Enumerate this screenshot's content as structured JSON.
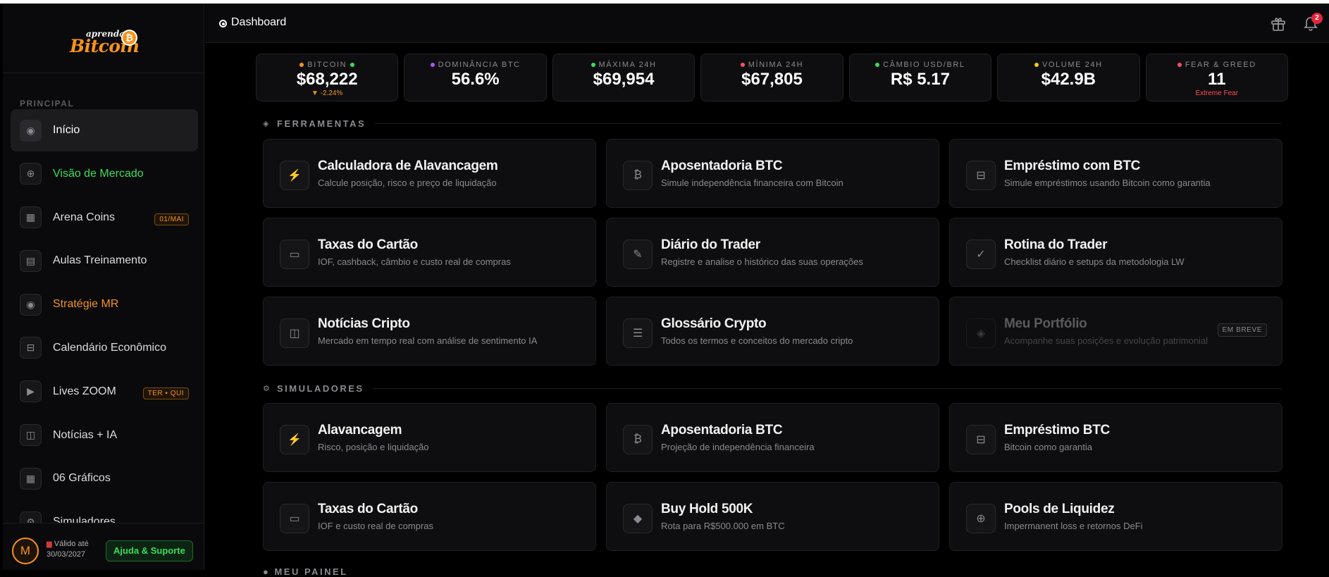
{
  "sidebar": {
    "logo_small": "aprenda",
    "logo_big": "Bitcoin",
    "logo_coin": "₿",
    "section_label": "PRINCIPAL",
    "items": [
      {
        "label": "Início",
        "icon": "target-icon",
        "glyph": "◉",
        "color": "white",
        "active": true
      },
      {
        "label": "Visão de Mercado",
        "icon": "globe-icon",
        "glyph": "⊕",
        "color": "green"
      },
      {
        "label": "Arena Coins",
        "icon": "store-icon",
        "glyph": "▦",
        "color": "default",
        "badge": "01/MAI"
      },
      {
        "label": "Aulas Treinamento",
        "icon": "book-icon",
        "glyph": "▤",
        "color": "default"
      },
      {
        "label": "Stratégie MR",
        "icon": "target-icon",
        "glyph": "◉",
        "color": "orange"
      },
      {
        "label": "Calendário Econômico",
        "icon": "calendar-icon",
        "glyph": "⊟",
        "color": "default"
      },
      {
        "label": "Lives ZOOM",
        "icon": "play-icon",
        "glyph": "▶",
        "color": "default",
        "badge": "TER • QUI"
      },
      {
        "label": "Notícias + IA",
        "icon": "news-icon",
        "glyph": "◫",
        "color": "default"
      },
      {
        "label": "06 Gráficos",
        "icon": "grid-icon",
        "glyph": "▦",
        "color": "default"
      },
      {
        "label": "Simuladores",
        "icon": "gear-icon",
        "glyph": "⚙",
        "color": "default"
      }
    ],
    "footer": {
      "avatar_letter": "M",
      "valid_label": "Válido até",
      "valid_date": "30/03/2027",
      "support_label": "Ajuda & Suporte"
    }
  },
  "header": {
    "title": "Dashboard",
    "notification_count": "2"
  },
  "stats": [
    {
      "label": "BITCOIN",
      "value": "$68,222",
      "sub": "▼ -2.24%",
      "sub_color": "orange",
      "dot": "#f7931a",
      "dot2": "#3ddc5c"
    },
    {
      "label": "DOMINÂNCIA BTC",
      "value": "56.6%",
      "dot": "#a855f7"
    },
    {
      "label": "MÁXIMA 24H",
      "value": "$69,954",
      "dot": "#3ddc5c"
    },
    {
      "label": "MÍNIMA 24H",
      "value": "$67,805",
      "dot": "#ff4d6d"
    },
    {
      "label": "CÂMBIO USD/BRL",
      "value": "R$ 5.17",
      "dot": "#3ddc5c"
    },
    {
      "label": "VOLUME 24H",
      "value": "$42.9B",
      "dot": "#f7c51a"
    },
    {
      "label": "FEAR & GREED",
      "value": "11",
      "sub": "Extreme Fear",
      "sub_color": "red",
      "dot": "#ff4d6d"
    }
  ],
  "ferramentas": {
    "title": "FERRAMENTAS",
    "glyph": "◈",
    "cards": [
      {
        "title": "Calculadora de Alavancagem",
        "desc": "Calcule posição, risco e preço de liquidação",
        "icon": "bolt-icon",
        "glyph": "⚡"
      },
      {
        "title": "Aposentadoria BTC",
        "desc": "Simule independência financeira com Bitcoin",
        "icon": "bitcoin-icon",
        "glyph": "₿"
      },
      {
        "title": "Empréstimo com BTC",
        "desc": "Simule empréstimos usando Bitcoin como garantia",
        "icon": "bank-icon",
        "glyph": "⊟"
      },
      {
        "title": "Taxas do Cartão",
        "desc": "IOF, cashback, câmbio e custo real de compras",
        "icon": "card-icon",
        "glyph": "▭"
      },
      {
        "title": "Diário do Trader",
        "desc": "Registre e analise o histórico das suas operações",
        "icon": "pencil-icon",
        "glyph": "✎"
      },
      {
        "title": "Rotina do Trader",
        "desc": "Checklist diário e setups da metodologia LW",
        "icon": "check-icon",
        "glyph": "✓"
      },
      {
        "title": "Notícias Cripto",
        "desc": "Mercado em tempo real com análise de sentimento IA",
        "icon": "news-icon",
        "glyph": "◫"
      },
      {
        "title": "Glossário Crypto",
        "desc": "Todos os termos e conceitos do mercado cripto",
        "icon": "list-icon",
        "glyph": "☰"
      },
      {
        "title": "Meu Portfólio",
        "desc": "Acompanhe suas posições e evolução patrimonial",
        "icon": "diamond-icon",
        "glyph": "◈",
        "disabled": true,
        "badge": "EM BREVE"
      }
    ]
  },
  "simuladores": {
    "title": "SIMULADORES",
    "glyph": "⚙",
    "cards": [
      {
        "title": "Alavancagem",
        "desc": "Risco, posição e liquidação",
        "icon": "bolt-icon",
        "glyph": "⚡"
      },
      {
        "title": "Aposentadoria BTC",
        "desc": "Projeção de independência financeira",
        "icon": "bitcoin-icon",
        "glyph": "₿"
      },
      {
        "title": "Empréstimo BTC",
        "desc": "Bitcoin como garantia",
        "icon": "bank-icon",
        "glyph": "⊟"
      },
      {
        "title": "Taxas do Cartão",
        "desc": "IOF e custo real de compras",
        "icon": "card-icon",
        "glyph": "▭"
      },
      {
        "title": "Buy Hold 500K",
        "desc": "Rota para R$500.000 em BTC",
        "icon": "diamond-icon",
        "glyph": "◆"
      },
      {
        "title": "Pools de Liquidez",
        "desc": "Impermanent loss e retornos DeFi",
        "icon": "globe-icon",
        "glyph": "⊕"
      }
    ]
  },
  "cut_section": "● MEU PAINEL"
}
